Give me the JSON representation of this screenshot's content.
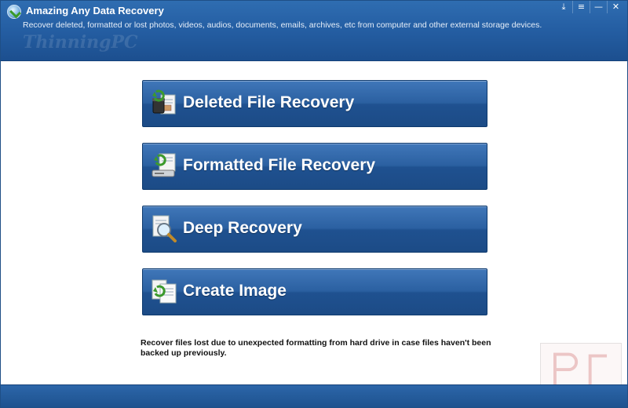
{
  "window": {
    "title": "Amazing Any Data Recovery",
    "subtitle": "Recover deleted, formatted or lost photos, videos, audios, documents, emails, archives, etc from computer and other external storage devices.",
    "watermark_text": "ThinningPC",
    "controls": {
      "download": "⤓",
      "menu": "≡",
      "minimize": "—",
      "close": "✕"
    }
  },
  "menu": {
    "items": [
      {
        "label": "Deleted File Recovery",
        "icon": "deleted-file-recovery-icon"
      },
      {
        "label": "Formatted File Recovery",
        "icon": "formatted-file-recovery-icon"
      },
      {
        "label": "Deep Recovery",
        "icon": "deep-recovery-icon"
      },
      {
        "label": "Create Image",
        "icon": "create-image-icon"
      }
    ]
  },
  "description": "Recover files lost due to unexpected formatting from hard drive in case files haven't been backed up previously.",
  "colors": {
    "header_blue": "#255fa4",
    "button_blue": "#2b60a1",
    "footer_blue": "#1e528f"
  }
}
